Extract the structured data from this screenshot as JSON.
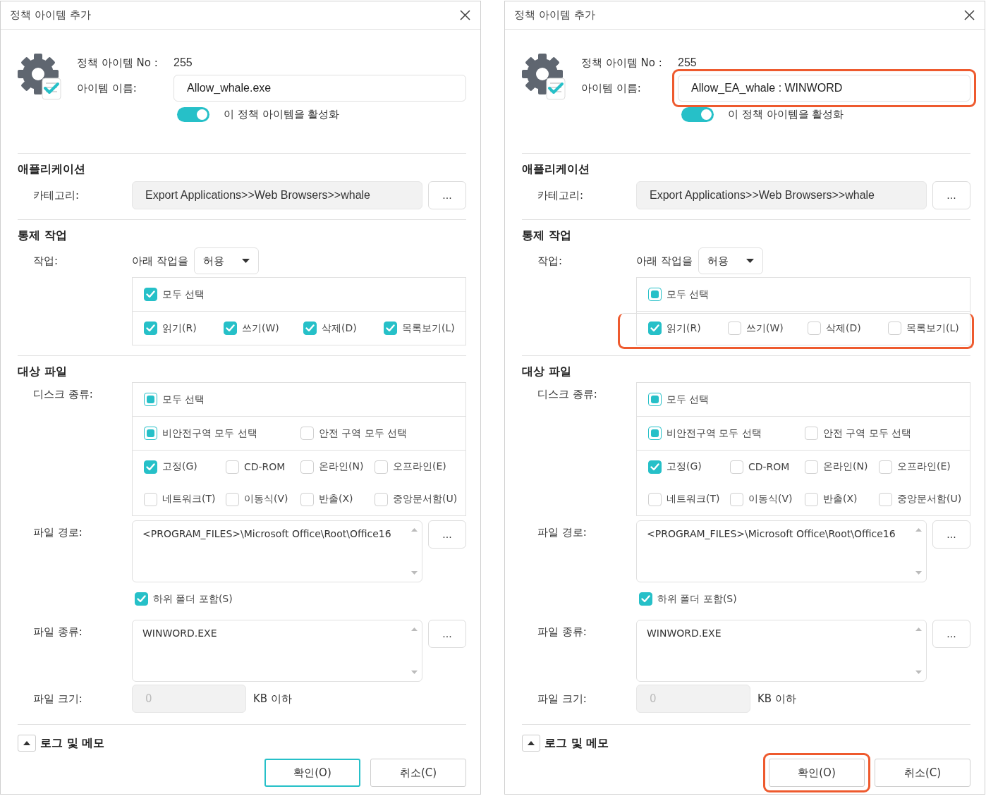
{
  "dialogs": [
    {
      "title": "정책 아이템 추가",
      "item_no_label": "정책 아이템 No :",
      "item_no": "255",
      "name_label": "아이템 이름:",
      "name_value": "Allow_whale.exe",
      "name_highlighted": false,
      "enable": {
        "label": "이 정책 아이템을 활성화",
        "on": true
      },
      "application": {
        "heading": "애플리케이션",
        "category_label": "카테고리:",
        "category_value": "Export Applications>>Web Browsers>>whale",
        "browse": "..."
      },
      "control": {
        "heading": "통제 작업",
        "action_label": "작업:",
        "prefix": "아래 작업을",
        "dropdown": "허용",
        "select_all": {
          "label": "모두 선택",
          "checked": true
        },
        "options_highlighted": false,
        "options": [
          {
            "label": "읽기(R)",
            "checked": true
          },
          {
            "label": "쓰기(W)",
            "checked": true
          },
          {
            "label": "삭제(D)",
            "checked": true
          },
          {
            "label": "목록보기(L)",
            "checked": true
          }
        ]
      },
      "target": {
        "heading": "대상 파일",
        "disk_label": "디스크 종류:",
        "disk_all": {
          "label": "모두 선택",
          "checked": false,
          "partial": true
        },
        "zones": [
          {
            "label": "비안전구역 모두 선택",
            "checked": false,
            "partial": true
          },
          {
            "label": "안전 구역 모두 선택",
            "checked": false,
            "partial": false
          }
        ],
        "disks": [
          {
            "label": "고정(G)",
            "checked": true
          },
          {
            "label": "CD-ROM",
            "checked": false
          },
          {
            "label": "온라인(N)",
            "checked": false
          },
          {
            "label": "오프라인(E)",
            "checked": false
          },
          {
            "label": "네트워크(T)",
            "checked": false
          },
          {
            "label": "이동식(V)",
            "checked": false
          },
          {
            "label": "반출(X)",
            "checked": false
          },
          {
            "label": "중앙문서함(U)",
            "checked": false
          }
        ],
        "path_label": "파일 경로:",
        "path_value": "<PROGRAM_FILES>\\Microsoft Office\\Root\\Office16",
        "path_browse": "...",
        "subfolder": {
          "label": "하위 폴더 포함(S)",
          "checked": true
        },
        "type_label": "파일 종류:",
        "type_value": "WINWORD.EXE",
        "type_browse": "...",
        "size_label": "파일 크기:",
        "size_value": "0",
        "size_disabled": true,
        "size_unit": "KB 이하"
      },
      "log": {
        "label": "로그 및 메모"
      },
      "buttons": [
        {
          "label": "확인(O)",
          "focused": true,
          "highlighted": false
        },
        {
          "label": "취소(C)",
          "focused": false,
          "highlighted": false
        }
      ]
    },
    {
      "title": "정책 아이템 추가",
      "item_no_label": "정책 아이템 No :",
      "item_no": "255",
      "name_label": "아이템 이름:",
      "name_value": "Allow_EA_whale : WINWORD",
      "name_highlighted": true,
      "enable": {
        "label": "이 정책 아이템을 활성화",
        "on": true
      },
      "application": {
        "heading": "애플리케이션",
        "category_label": "카테고리:",
        "category_value": "Export Applications>>Web Browsers>>whale",
        "browse": "..."
      },
      "control": {
        "heading": "통제 작업",
        "action_label": "작업:",
        "prefix": "아래 작업을",
        "dropdown": "허용",
        "select_all": {
          "label": "모두 선택",
          "checked": false,
          "partial": true
        },
        "options_highlighted": true,
        "options": [
          {
            "label": "읽기(R)",
            "checked": true
          },
          {
            "label": "쓰기(W)",
            "checked": false
          },
          {
            "label": "삭제(D)",
            "checked": false
          },
          {
            "label": "목록보기(L)",
            "checked": false
          }
        ]
      },
      "target": {
        "heading": "대상 파일",
        "disk_label": "디스크 종류:",
        "disk_all": {
          "label": "모두 선택",
          "checked": false,
          "partial": true
        },
        "zones": [
          {
            "label": "비안전구역 모두 선택",
            "checked": false,
            "partial": true
          },
          {
            "label": "안전 구역 모두 선택",
            "checked": false,
            "partial": false
          }
        ],
        "disks": [
          {
            "label": "고정(G)",
            "checked": true
          },
          {
            "label": "CD-ROM",
            "checked": false
          },
          {
            "label": "온라인(N)",
            "checked": false
          },
          {
            "label": "오프라인(E)",
            "checked": false
          },
          {
            "label": "네트워크(T)",
            "checked": false
          },
          {
            "label": "이동식(V)",
            "checked": false
          },
          {
            "label": "반출(X)",
            "checked": false
          },
          {
            "label": "중앙문서함(U)",
            "checked": false
          }
        ],
        "path_label": "파일 경로:",
        "path_value": "<PROGRAM_FILES>\\Microsoft Office\\Root\\Office16",
        "path_browse": "...",
        "subfolder": {
          "label": "하위 폴더 포함(S)",
          "checked": true
        },
        "type_label": "파일 종류:",
        "type_value": "WINWORD.EXE",
        "type_browse": "...",
        "size_label": "파일 크기:",
        "size_value": "0",
        "size_disabled": true,
        "size_unit": "KB 이하"
      },
      "log": {
        "label": "로그 및 메모"
      },
      "buttons": [
        {
          "label": "확인(O)",
          "focused": false,
          "highlighted": true
        },
        {
          "label": "취소(C)",
          "focused": false,
          "highlighted": false
        }
      ]
    }
  ]
}
